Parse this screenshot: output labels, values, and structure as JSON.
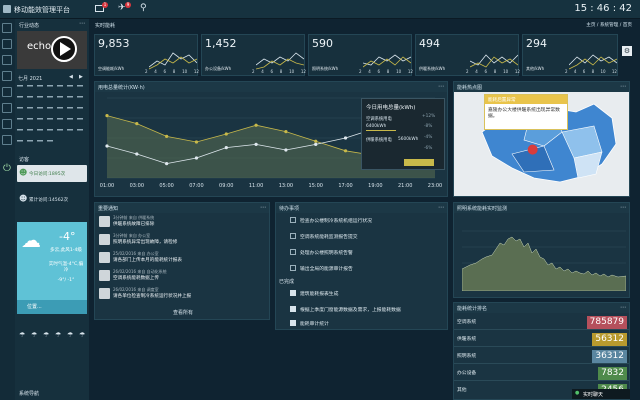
{
  "header": {
    "app_title": "移动能效管理平台",
    "mail_badge": "1",
    "alarm_badge": "9",
    "clock": "15 : 46 : 42"
  },
  "sidebar": {
    "industry_label": "行业动态",
    "video_label": "echo",
    "calendar_month": "七月 2021",
    "visitors_label": "访客",
    "today_visits": "今日访问:1895次",
    "total_visits": "累计访问:14562次",
    "weather_temp": "-4°",
    "weather_desc": "多云,此风1-4级",
    "weather_air": "实时气温-4°C,偏冷",
    "weather_range": "-9°/ -1°",
    "weather_location": "位置...",
    "nav_footer": "系统导航"
  },
  "breadcrumb": {
    "section": "实时能耗",
    "home": "主页",
    "level2": "系统管理",
    "current": "首页"
  },
  "stats": [
    {
      "value": "9,853",
      "label": "空调能耗/kWh"
    },
    {
      "value": "1,452",
      "label": "办公设备/kWh"
    },
    {
      "value": "590",
      "label": "照明系统/kWh"
    },
    {
      "value": "494",
      "label": "供暖系统/kWh"
    },
    {
      "value": "294",
      "label": "其他/kWh"
    }
  ],
  "stat_ticks": [
    "2",
    "4",
    "6",
    "8",
    "10",
    "12"
  ],
  "energy_chart": {
    "title": "用电总量统计(KW·h)",
    "tooltip_title": "今日用电总量(kWh)",
    "tooltip_items": [
      {
        "label": "空调系统用电",
        "value": "6400kWh",
        "delta": "+12%"
      },
      {
        "label": "供暖系统用电",
        "value": "5600kWh",
        "delta": "-8%"
      }
    ],
    "tooltip_deltas": [
      "+12%",
      "-8%",
      "-4%",
      "-6%"
    ],
    "colors": {
      "line_a": "#c8b94a",
      "line_b": "#dfe8ee",
      "area": "#5a6e52"
    }
  },
  "chart_data": {
    "type": "line",
    "x": [
      "01:00",
      "03:00",
      "05:00",
      "07:00",
      "09:00",
      "11:00",
      "13:00",
      "15:00",
      "17:00",
      "19:00",
      "21:00",
      "23:00"
    ],
    "ylim": [
      0,
      1
    ],
    "series": [
      {
        "values": [
          0.78,
          0.68,
          0.52,
          0.45,
          0.55,
          0.66,
          0.58,
          0.46,
          0.34,
          0.28,
          0.4,
          0.55
        ]
      },
      {
        "values": [
          0.4,
          0.3,
          0.18,
          0.25,
          0.38,
          0.42,
          0.35,
          0.42,
          0.5,
          0.62,
          0.56,
          0.3
        ]
      }
    ]
  },
  "map": {
    "title": "能耗热点图",
    "popup_title": "能耗后置异常",
    "popup_text": "嘉陵办公大楼供暖系统出现异常数据。"
  },
  "notice": {
    "title": "重要通知",
    "items": [
      {
        "meta": "3分钟前 来自 供暖系统",
        "text": "供暖系统故障已排除"
      },
      {
        "meta": "3分钟前 来自 办公室",
        "text": "照明系统异常出现故障，请检修"
      },
      {
        "meta": "25/02/2016 来自 办公室",
        "text": "请各部门上传本月的能耗统计报表"
      },
      {
        "meta": "26/02/2016 来自 自动化系统",
        "text": "空调系统能耗数据上传"
      },
      {
        "meta": "26/02/2016 来自 调度室",
        "text": "请各单位检查制冷系统运行状况并上报"
      }
    ],
    "more": "查看所有"
  },
  "tasks": {
    "title": "待办事项",
    "items": [
      "检查办公楼制冷系统机组运行状况",
      "空调系统能耗监测报告提交",
      "处理办公楼照明系统告警",
      "输出全局的能源审计报告"
    ],
    "done_label": "已完成",
    "done_items": [
      "建筑能耗报表生成",
      "根据上季度门窗能源数据及需求，上报能耗数据",
      "能耗审计统计"
    ]
  },
  "realtime": {
    "title": "照明系统能耗实时监测"
  },
  "ranking": {
    "title": "能耗统计排名",
    "items": [
      {
        "name": "空调系统",
        "value": "785879",
        "color": "#b5505c"
      },
      {
        "name": "供暖系统",
        "value": "56312",
        "color": "#b89a2e"
      },
      {
        "name": "照明系统",
        "value": "36312",
        "color": "#5a86a0"
      },
      {
        "name": "办公设备",
        "value": "7832",
        "color": "#4f8a4b"
      },
      {
        "name": "其他",
        "value": "2456",
        "color": "#4f8a4b"
      }
    ],
    "live_label": "实时聊天"
  }
}
